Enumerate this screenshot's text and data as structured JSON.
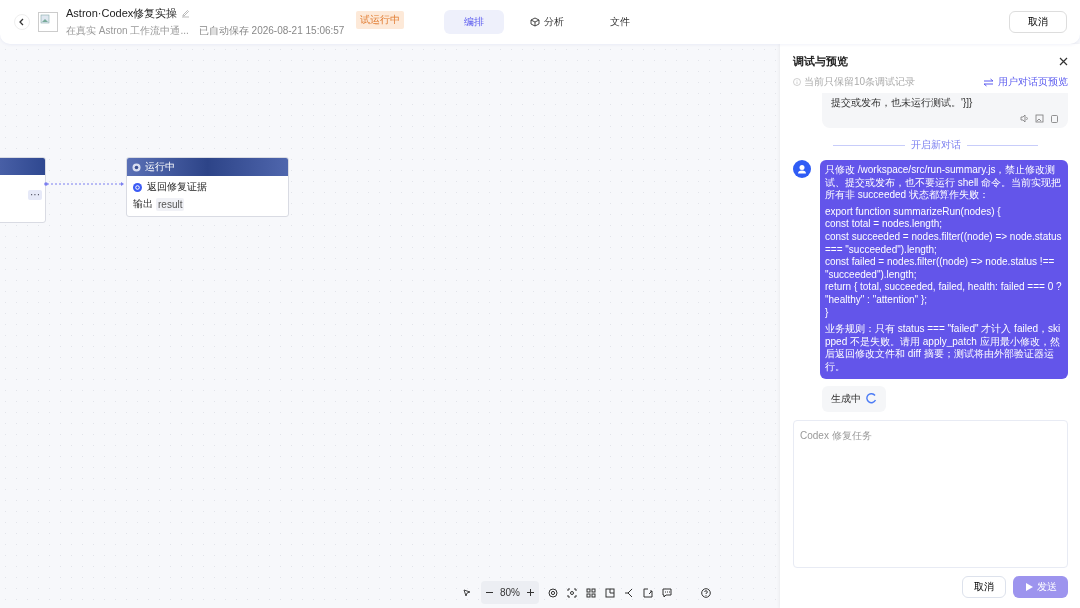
{
  "header": {
    "title": "Astron·Codex修复实操",
    "description": "在真实 Astron 工作流中通...",
    "save_status": "已自动保存 2026-08-21 15:06:57",
    "run_badge": "试运行中",
    "tabs": [
      {
        "label": "编排",
        "selected": true,
        "kind": "plain"
      },
      {
        "label": "分析",
        "selected": false,
        "kind": "icon"
      },
      {
        "label": "文件",
        "selected": false,
        "kind": "plain"
      }
    ],
    "cancel": "取消"
  },
  "canvas": {
    "nodes": [
      {
        "kind": "partial",
        "more": "···"
      },
      {
        "kind": "full",
        "status": "运行中",
        "title": "返回修复证据",
        "output_label": "输出",
        "output_value": "result"
      }
    ],
    "zoom": "80%"
  },
  "panel": {
    "title": "调试与预览",
    "notice": "当前只保留10条调试记录",
    "preview_link": "用户对话页预览",
    "previous_reply": "提交或发布，也未运行测试。'}]}",
    "divider": "开启新对话",
    "user_message": {
      "intro": "只修改 /workspace/src/run-summary.js，禁止修改测试、提交或发布，也不要运行 shell 命令。当前实现把所有非 succeeded 状态都算作失败：",
      "code": [
        "export function summarizeRun(nodes) {",
        "const total = nodes.length;",
        "const succeeded = nodes.filter((node) => node.status === \"succeeded\").length;",
        "const failed = nodes.filter((node) => node.status !== \"succeeded\").length;",
        "return { total, succeeded, failed, health: failed === 0 ? \"healthy\" : \"attention\" };",
        "}"
      ],
      "rules": "业务规则：只有 status === \"failed\" 才计入 failed，skipped 不是失败。请用 apply_patch 应用最小修改，然后返回修改文件和 diff 摘要；测试将由外部验证器运行。"
    },
    "generating": "生成中",
    "input_placeholder": "Codex 修复任务",
    "cancel": "取消",
    "send": "发送",
    "send_disabled": true
  }
}
